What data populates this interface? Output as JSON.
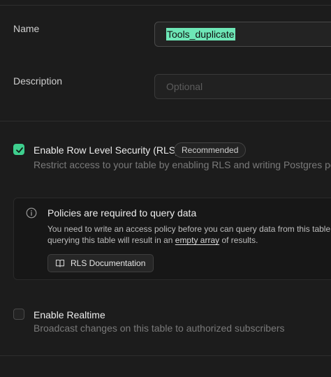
{
  "form": {
    "name_label": "Name",
    "name_value": "Tools_duplicate",
    "description_label": "Description",
    "description_placeholder": "Optional"
  },
  "rls": {
    "checked": true,
    "title": "Enable Row Level Security (RLS)",
    "badge": "Recommended",
    "description": "Restrict access to your table by enabling RLS and writing Postgres policies."
  },
  "alert": {
    "icon": "info-icon",
    "title": "Policies are required to query data",
    "line1": "You need to write an access policy before you can query data from this table. W",
    "line2_before": "querying this table will result in an ",
    "line2_link": "empty array",
    "line2_after": " of results.",
    "button_icon": "book-icon",
    "button_label": "RLS Documentation"
  },
  "realtime": {
    "checked": false,
    "title": "Enable Realtime",
    "description": "Broadcast changes on this table to authorized subscribers"
  },
  "colors": {
    "accent": "#3ecf8e",
    "selection": "#6ee7b7",
    "background": "#1c1c1c"
  }
}
